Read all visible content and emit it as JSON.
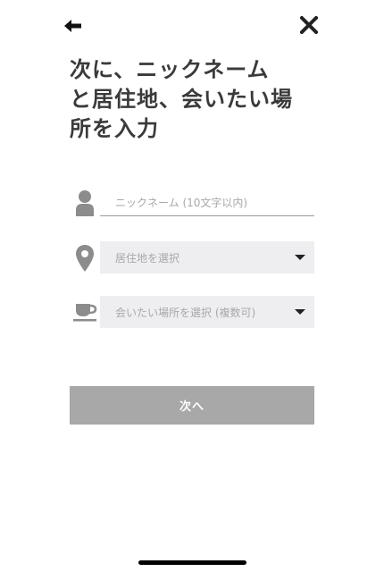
{
  "header": {
    "back_icon": "arrow-left-icon",
    "close_icon": "close-icon"
  },
  "title": {
    "line1": "次に、ニックネーム",
    "line2": "と居住地、会いたい場",
    "line3": "所を入力"
  },
  "form": {
    "nickname": {
      "icon": "person-icon",
      "value": "",
      "placeholder": "ニックネーム (10文字以内)"
    },
    "residence": {
      "icon": "location-pin-icon",
      "placeholder": "居住地を選択"
    },
    "places": {
      "icon": "coffee-cup-icon",
      "placeholder": "会いたい場所を選択 (複数可)"
    }
  },
  "next_button": {
    "label": "次へ"
  },
  "colors": {
    "title_text": "#3a3a3a",
    "icon_gray": "#8c8c8c",
    "select_bg": "#eeeef1",
    "placeholder": "#a8a8a8",
    "button_disabled_bg": "#a8a8a8",
    "button_text": "#ffffff"
  }
}
